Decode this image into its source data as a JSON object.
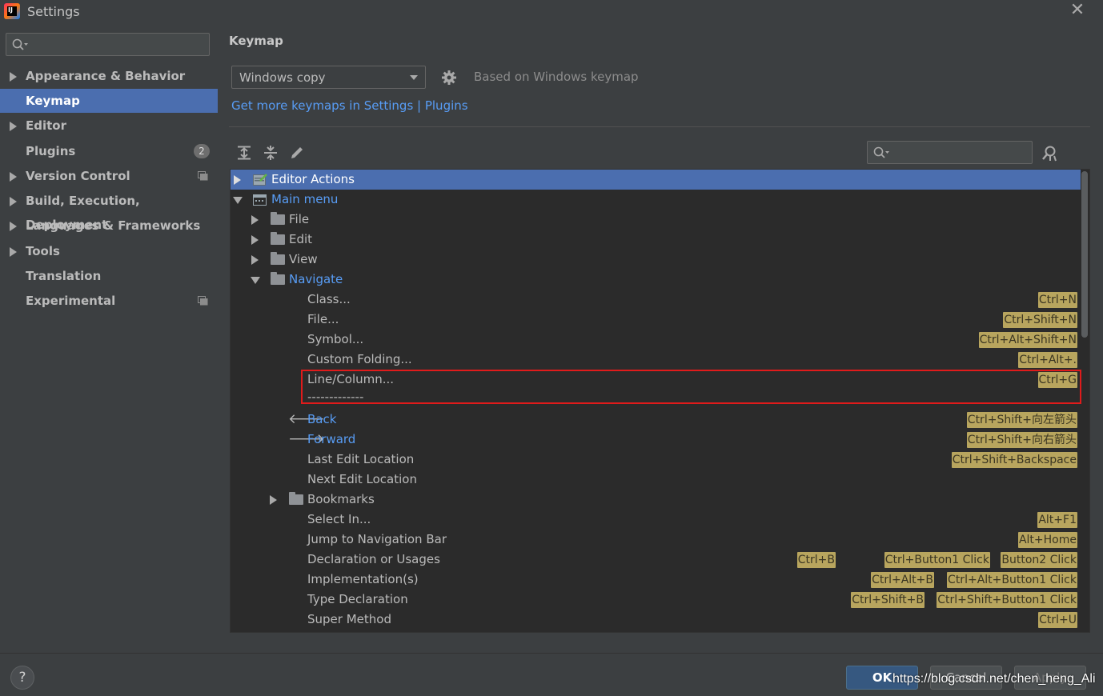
{
  "window": {
    "title": "Settings"
  },
  "sidebar": {
    "search_placeholder": "",
    "items": [
      {
        "label": "Appearance & Behavior",
        "expandable": true
      },
      {
        "label": "Keymap",
        "selected": true
      },
      {
        "label": "Editor",
        "expandable": true
      },
      {
        "label": "Plugins",
        "badge": "2"
      },
      {
        "label": "Version Control",
        "expandable": true,
        "project_icon": true
      },
      {
        "label": "Build, Execution, Deployment",
        "expandable": true
      },
      {
        "label": "Languages & Frameworks",
        "expandable": true
      },
      {
        "label": "Tools",
        "expandable": true
      },
      {
        "label": "Translation"
      },
      {
        "label": "Experimental",
        "project_icon": true
      }
    ]
  },
  "main": {
    "title": "Keymap",
    "keymap_combo": {
      "value": "Windows copy"
    },
    "based_on": "Based on Windows keymap",
    "more_keymaps_link": "Get more keymaps in Settings | Plugins",
    "toolbar_icons": [
      "expand-all-icon",
      "collapse-all-icon",
      "edit-icon"
    ],
    "tree_search_placeholder": ""
  },
  "tree": {
    "rows": [
      {
        "label": "Editor Actions",
        "selected": true
      },
      {
        "label": "Main menu"
      },
      {
        "label": "File"
      },
      {
        "label": "Edit"
      },
      {
        "label": "View"
      },
      {
        "label": "Navigate"
      },
      {
        "label": "Class...",
        "shortcuts": [
          "Ctrl+N"
        ]
      },
      {
        "label": "File...",
        "shortcuts": [
          "Ctrl+Shift+N"
        ]
      },
      {
        "label": "Symbol...",
        "shortcuts": [
          "Ctrl+Alt+Shift+N"
        ]
      },
      {
        "label": "Custom Folding...",
        "shortcuts": [
          "Ctrl+Alt+."
        ]
      },
      {
        "label": "Line/Column...",
        "shortcuts": [
          "Ctrl+G"
        ]
      },
      {
        "label": "-------------"
      },
      {
        "label": "Back",
        "shortcuts": [
          "Ctrl+Shift+向左箭头"
        ]
      },
      {
        "label": "Forward",
        "shortcuts": [
          "Ctrl+Shift+向右箭头"
        ]
      },
      {
        "label": "Last Edit Location",
        "shortcuts": [
          "Ctrl+Shift+Backspace"
        ]
      },
      {
        "label": "Next Edit Location"
      },
      {
        "label": "Bookmarks"
      },
      {
        "label": "Select In...",
        "shortcuts": [
          "Alt+F1"
        ]
      },
      {
        "label": "Jump to Navigation Bar",
        "shortcuts": [
          "Alt+Home"
        ]
      },
      {
        "label": "Declaration or Usages",
        "shortcuts": [
          "Ctrl+B",
          "Ctrl+Button1 Click",
          "Button2 Click"
        ]
      },
      {
        "label": "Implementation(s)",
        "shortcuts": [
          "Ctrl+Alt+B",
          "Ctrl+Alt+Button1 Click"
        ]
      },
      {
        "label": "Type Declaration",
        "shortcuts": [
          "Ctrl+Shift+B",
          "Ctrl+Shift+Button1 Click"
        ]
      },
      {
        "label": "Super Method",
        "shortcuts": [
          "Ctrl+U"
        ]
      }
    ]
  },
  "buttons": {
    "ok": "OK",
    "cancel": "Cancel",
    "apply": "Apply",
    "help": "?"
  },
  "watermark": "https://blog.csdn.net/chen_heng_Ali",
  "colors": {
    "selection": "#4b6eaf",
    "link": "#589df6",
    "shortcut_bg": "#b8a55e",
    "highlight_box": "#e01b1b"
  }
}
